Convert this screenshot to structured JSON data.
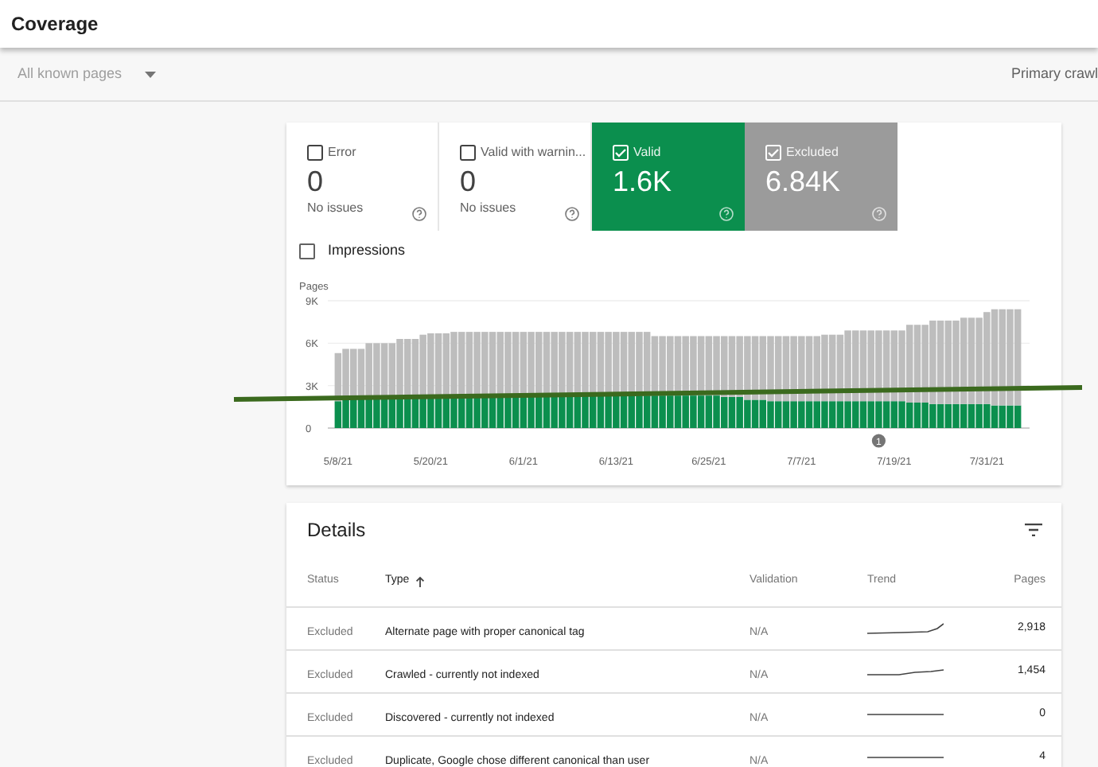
{
  "header": {
    "title": "Coverage"
  },
  "filter_bar": {
    "dropdown": "All known pages",
    "right_label": "Primary crawl"
  },
  "summary_tiles": [
    {
      "label": "Error",
      "value": "0",
      "subtitle": "No issues",
      "checked": false
    },
    {
      "label": "Valid with warnin...",
      "value": "0",
      "subtitle": "No issues",
      "checked": false
    },
    {
      "label": "Valid",
      "value": "1.6K",
      "checked": true,
      "color": "#0b8f4e"
    },
    {
      "label": "Excluded",
      "value": "6.84K",
      "checked": true,
      "color": "#9b9b9b"
    }
  ],
  "impressions": {
    "label": "Impressions",
    "checked": false
  },
  "chart": {
    "chart_data": {
      "type": "bar",
      "stacked": true,
      "ylabel": "Pages",
      "ylim": [
        0,
        9000
      ],
      "yticks": [
        {
          "value": 0,
          "label": "0"
        },
        {
          "value": 3000,
          "label": "3K"
        },
        {
          "value": 6000,
          "label": "6K"
        },
        {
          "value": 9000,
          "label": "9K"
        }
      ],
      "categories": [
        "5/8/21",
        null,
        null,
        null,
        null,
        null,
        null,
        null,
        null,
        null,
        null,
        null,
        "5/20/21",
        null,
        null,
        null,
        null,
        null,
        null,
        null,
        null,
        null,
        null,
        null,
        "6/1/21",
        null,
        null,
        null,
        null,
        null,
        null,
        null,
        null,
        null,
        null,
        null,
        "6/13/21",
        null,
        null,
        null,
        null,
        null,
        null,
        null,
        null,
        null,
        null,
        null,
        "6/25/21",
        null,
        null,
        null,
        null,
        null,
        null,
        null,
        null,
        null,
        null,
        null,
        "7/7/21",
        null,
        null,
        null,
        null,
        null,
        null,
        null,
        null,
        null,
        null,
        null,
        "7/19/21",
        null,
        null,
        null,
        null,
        null,
        null,
        null,
        null,
        null,
        null,
        null,
        "7/31/21",
        null,
        null,
        null,
        null
      ],
      "series": [
        {
          "color": "#0b8f4e",
          "values": [
            1900,
            2200,
            2200,
            2200,
            2300,
            2300,
            2300,
            2300,
            2300,
            2300,
            2300,
            2300,
            2300,
            2300,
            2300,
            2300,
            2300,
            2300,
            2300,
            2300,
            2300,
            2300,
            2300,
            2300,
            2300,
            2300,
            2300,
            2300,
            2300,
            2300,
            2300,
            2300,
            2300,
            2300,
            2300,
            2300,
            2300,
            2300,
            2300,
            2300,
            2300,
            2300,
            2300,
            2300,
            2300,
            2300,
            2300,
            2300,
            2300,
            2300,
            2200,
            2200,
            2200,
            2000,
            2000,
            2000,
            1900,
            1900,
            1900,
            1900,
            1900,
            1900,
            1900,
            1900,
            1900,
            1900,
            1900,
            1900,
            1900,
            1900,
            1900,
            1900,
            1900,
            1900,
            1800,
            1800,
            1800,
            1700,
            1700,
            1700,
            1700,
            1700,
            1700,
            1700,
            1700,
            1600,
            1600,
            1600,
            1600
          ]
        },
        {
          "color": "#bdbdbd",
          "values": [
            3400,
            3400,
            3400,
            3400,
            3700,
            3700,
            3700,
            3700,
            4000,
            4000,
            4000,
            4300,
            4400,
            4400,
            4400,
            4500,
            4500,
            4500,
            4500,
            4500,
            4500,
            4500,
            4500,
            4500,
            4500,
            4500,
            4500,
            4500,
            4500,
            4500,
            4500,
            4500,
            4500,
            4500,
            4500,
            4500,
            4500,
            4500,
            4500,
            4500,
            4500,
            4200,
            4200,
            4200,
            4200,
            4200,
            4200,
            4200,
            4200,
            4200,
            4300,
            4300,
            4300,
            4500,
            4500,
            4500,
            4600,
            4600,
            4600,
            4600,
            4600,
            4600,
            4600,
            4700,
            4700,
            4700,
            5000,
            5000,
            5000,
            5000,
            5000,
            5000,
            5000,
            5000,
            5500,
            5500,
            5500,
            5900,
            5900,
            5900,
            5900,
            6100,
            6100,
            6100,
            6500,
            6800,
            6800,
            6800,
            6800
          ]
        }
      ],
      "annotations": [
        "1"
      ]
    }
  },
  "markup_line": {
    "color": "#3b6a1e"
  },
  "details": {
    "title": "Details",
    "columns": [
      {
        "label": "Status",
        "sorted": false
      },
      {
        "label": "Type",
        "sorted": true
      },
      {
        "label": "Validation",
        "sorted": false
      },
      {
        "label": "Trend",
        "sorted": false
      },
      {
        "label": "Pages",
        "sorted": false
      }
    ],
    "rows": [
      {
        "status": "Excluded",
        "type": "Alternate page with proper canonical tag",
        "validation": "N/A",
        "kind": "rising",
        "pages": "2,918"
      },
      {
        "status": "Excluded",
        "type": "Crawled - currently not indexed",
        "validation": "N/A",
        "kind": "slight",
        "pages": "1,454"
      },
      {
        "status": "Excluded",
        "type": "Discovered - currently not indexed",
        "validation": "N/A",
        "kind": "flat",
        "pages": "0"
      },
      {
        "status": "Excluded",
        "type": "Duplicate, Google chose different canonical than user",
        "validation": "N/A",
        "kind": "flat",
        "pages": "4"
      }
    ]
  }
}
